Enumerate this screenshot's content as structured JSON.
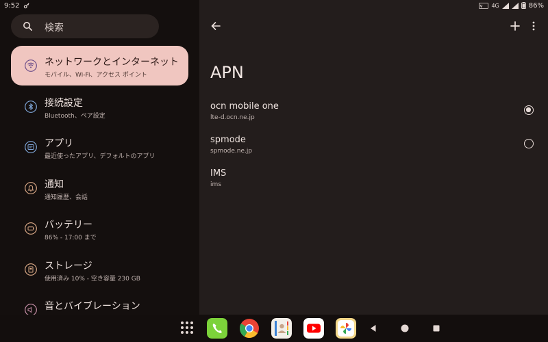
{
  "status_bar": {
    "time": "9:52",
    "network": "4G",
    "battery": "86%"
  },
  "search": {
    "placeholder": "検索",
    "icon": "search-icon"
  },
  "sidebar": {
    "items": [
      {
        "title": "ネットワークとインターネット",
        "subtitle": "モバイル、Wi-Fi、アクセス ポイント",
        "icon": "wifi-icon",
        "selected": true
      },
      {
        "title": "接続設定",
        "subtitle": "Bluetooth、ペア設定",
        "icon": "bluetooth-icon"
      },
      {
        "title": "アプリ",
        "subtitle": "最近使ったアプリ、デフォルトのアプリ",
        "icon": "apps-icon"
      },
      {
        "title": "通知",
        "subtitle": "通知履歴、会話",
        "icon": "bell-icon"
      },
      {
        "title": "バッテリー",
        "subtitle": "86% - 17:00 まで",
        "icon": "battery-icon"
      },
      {
        "title": "ストレージ",
        "subtitle": "使用済み 10% - 空き容量 230 GB",
        "icon": "storage-icon"
      },
      {
        "title": "音とバイブレーション",
        "subtitle": "",
        "icon": "volume-icon"
      }
    ]
  },
  "main": {
    "title": "APN",
    "apns": [
      {
        "name": "ocn mobile one",
        "apn": "lte-d.ocn.ne.jp",
        "selected": true,
        "has_radio": true
      },
      {
        "name": "spmode",
        "apn": "spmode.ne.jp",
        "selected": false,
        "has_radio": true
      },
      {
        "name": "IMS",
        "apn": "ims",
        "selected": false,
        "has_radio": false
      }
    ]
  },
  "taskbar": {
    "apps": [
      "phone-icon",
      "chrome-icon",
      "contacts-icon",
      "youtube-icon",
      "photos-icon"
    ]
  },
  "colors": {
    "selected_bg": "#f0c6c0",
    "left_bg": "#140f0e",
    "right_bg": "#231d1c",
    "accent_icon": "#c9a28f"
  }
}
